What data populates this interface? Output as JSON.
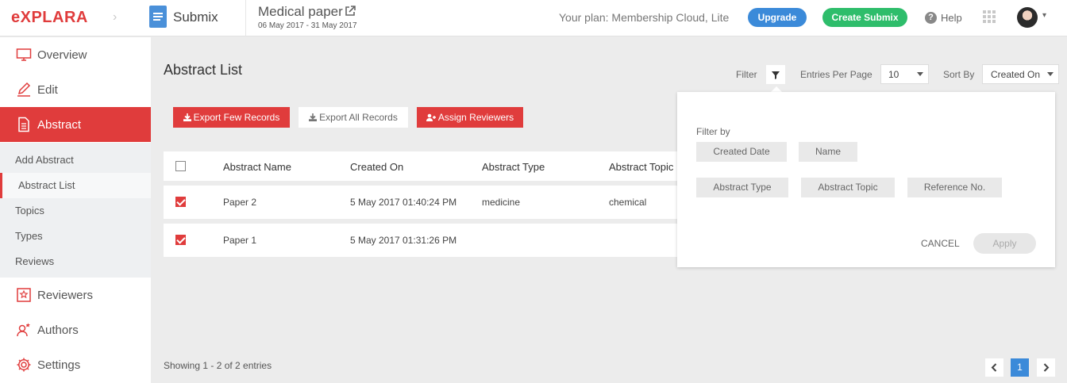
{
  "topbar": {
    "logo": "eXPLARA",
    "app_name": "Submix",
    "event_title": "Medical paper",
    "event_dates": "06 May 2017 - 31 May 2017",
    "plan_text": "Your plan: Membership Cloud, Lite",
    "upgrade_label": "Upgrade",
    "create_label": "Create Submix",
    "help_label": "Help"
  },
  "sidebar": {
    "items": [
      {
        "label": "Overview",
        "icon": "monitor-icon"
      },
      {
        "label": "Edit",
        "icon": "pencil-icon"
      },
      {
        "label": "Abstract",
        "icon": "document-icon"
      },
      {
        "label": "Reviewers",
        "icon": "reviewer-icon"
      },
      {
        "label": "Authors",
        "icon": "authors-icon"
      },
      {
        "label": "Settings",
        "icon": "gear-icon"
      }
    ],
    "subitems": [
      "Add Abstract",
      "Abstract List",
      "Topics",
      "Types",
      "Reviews"
    ]
  },
  "main": {
    "title": "Abstract List",
    "filter_label": "Filter",
    "entries_label": "Entries Per Page",
    "entries_value": "10",
    "sort_label": "Sort By",
    "sort_value": "Created On",
    "buttons": {
      "export_few": "Export Few Records",
      "export_all": "Export All Records",
      "assign": "Assign Reviewers"
    },
    "table": {
      "headers": [
        "Abstract Name",
        "Created On",
        "Abstract Type",
        "Abstract Topic"
      ],
      "rows": [
        {
          "name": "Paper 2",
          "created": "5 May 2017 01:40:24 PM",
          "type": "medicine",
          "topic": "chemical",
          "checked": true
        },
        {
          "name": "Paper 1",
          "created": "5 May 2017 01:31:26 PM",
          "type": "",
          "topic": "",
          "checked": true
        }
      ]
    },
    "showing": "Showing 1 - 2 of 2 entries",
    "page": "1"
  },
  "filter_popover": {
    "title": "Filter by",
    "chips": [
      "Created Date",
      "Name",
      "Abstract Type",
      "Abstract Topic",
      "Reference No."
    ],
    "cancel": "CANCEL",
    "apply": "Apply"
  },
  "colors": {
    "accent_red": "#e03c3c",
    "upgrade_blue": "#3b8ad9",
    "create_green": "#2ebd6b"
  }
}
